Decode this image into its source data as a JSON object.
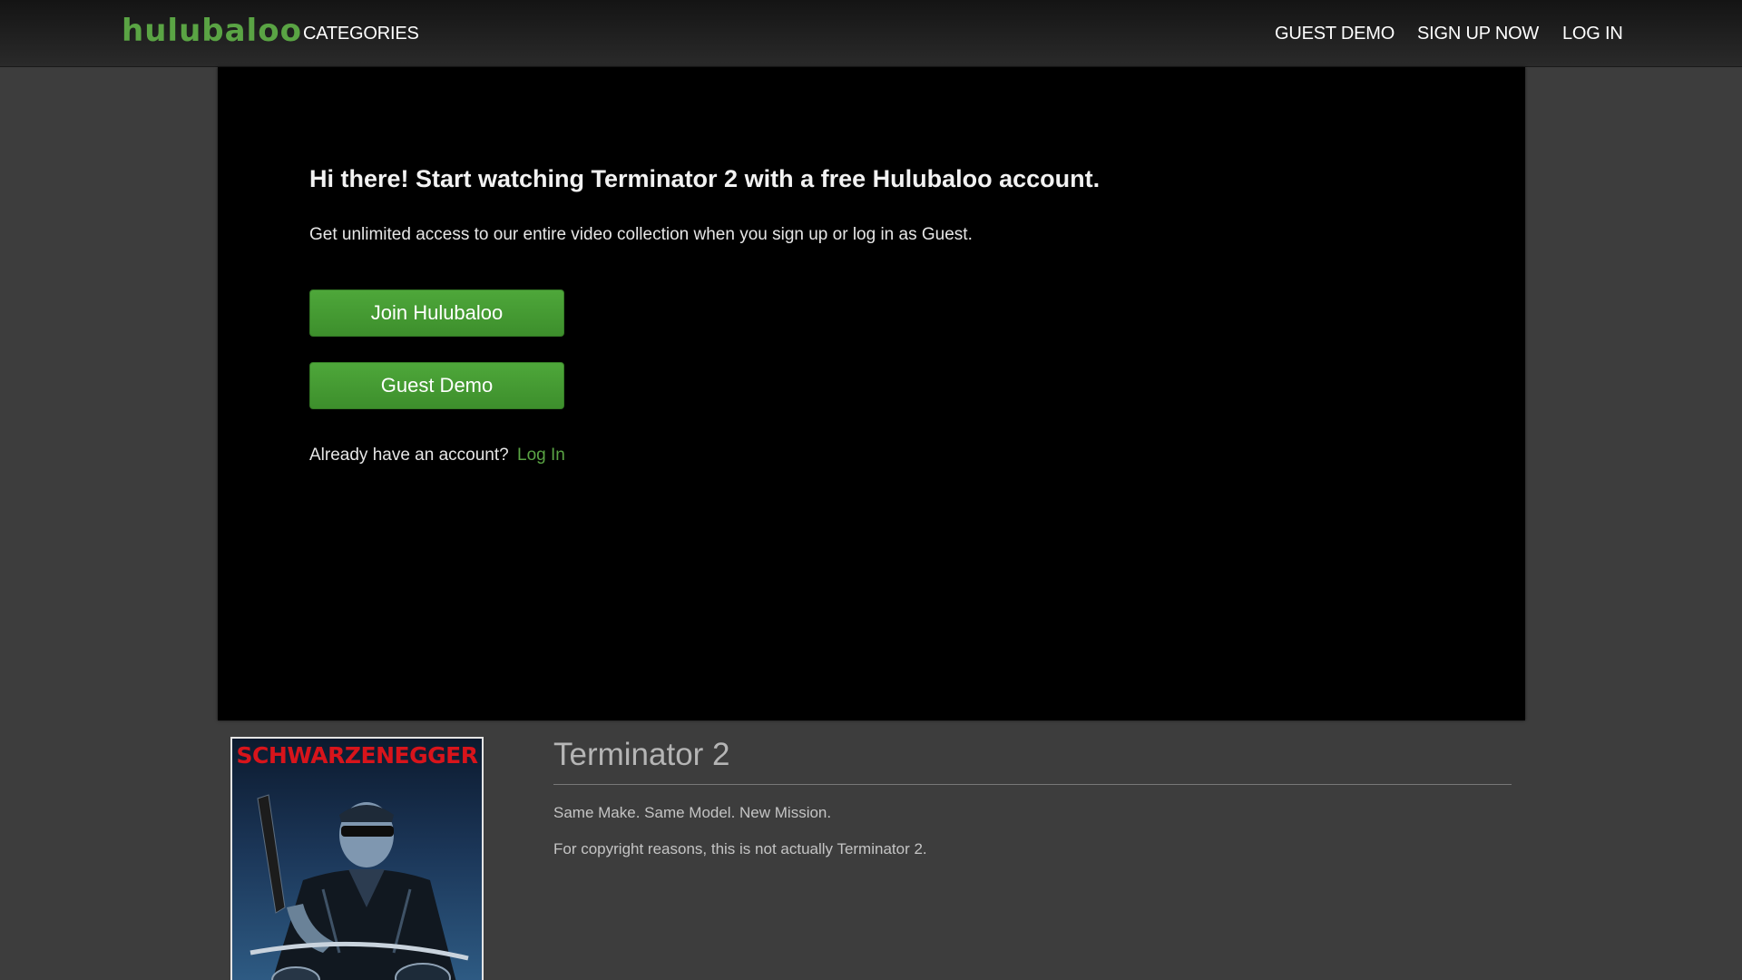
{
  "navbar": {
    "logo": "hulubaloo",
    "categories": "CATEGORIES",
    "guest_demo": "GUEST DEMO",
    "sign_up": "SIGN UP NOW",
    "log_in": "LOG IN"
  },
  "promo": {
    "title": "Hi there! Start watching Terminator 2 with a free Hulubaloo account.",
    "subtitle": "Get unlimited access to our entire video collection when you sign up or log in as Guest.",
    "join_button": "Join Hulubaloo",
    "guest_button": "Guest Demo",
    "already_text": "Already have an account?",
    "login_link": "Log In"
  },
  "movie": {
    "poster_text": "SCHWARZENEGGER",
    "title": "Terminator 2",
    "tagline": "Same Make. Same Model. New Mission.",
    "note": "For copyright reasons, this is not actually Terminator 2."
  },
  "colors": {
    "brand_green": "#5aa444",
    "button_green": "#46a035",
    "page_bg": "#3d3d3d",
    "player_bg": "#000000"
  }
}
